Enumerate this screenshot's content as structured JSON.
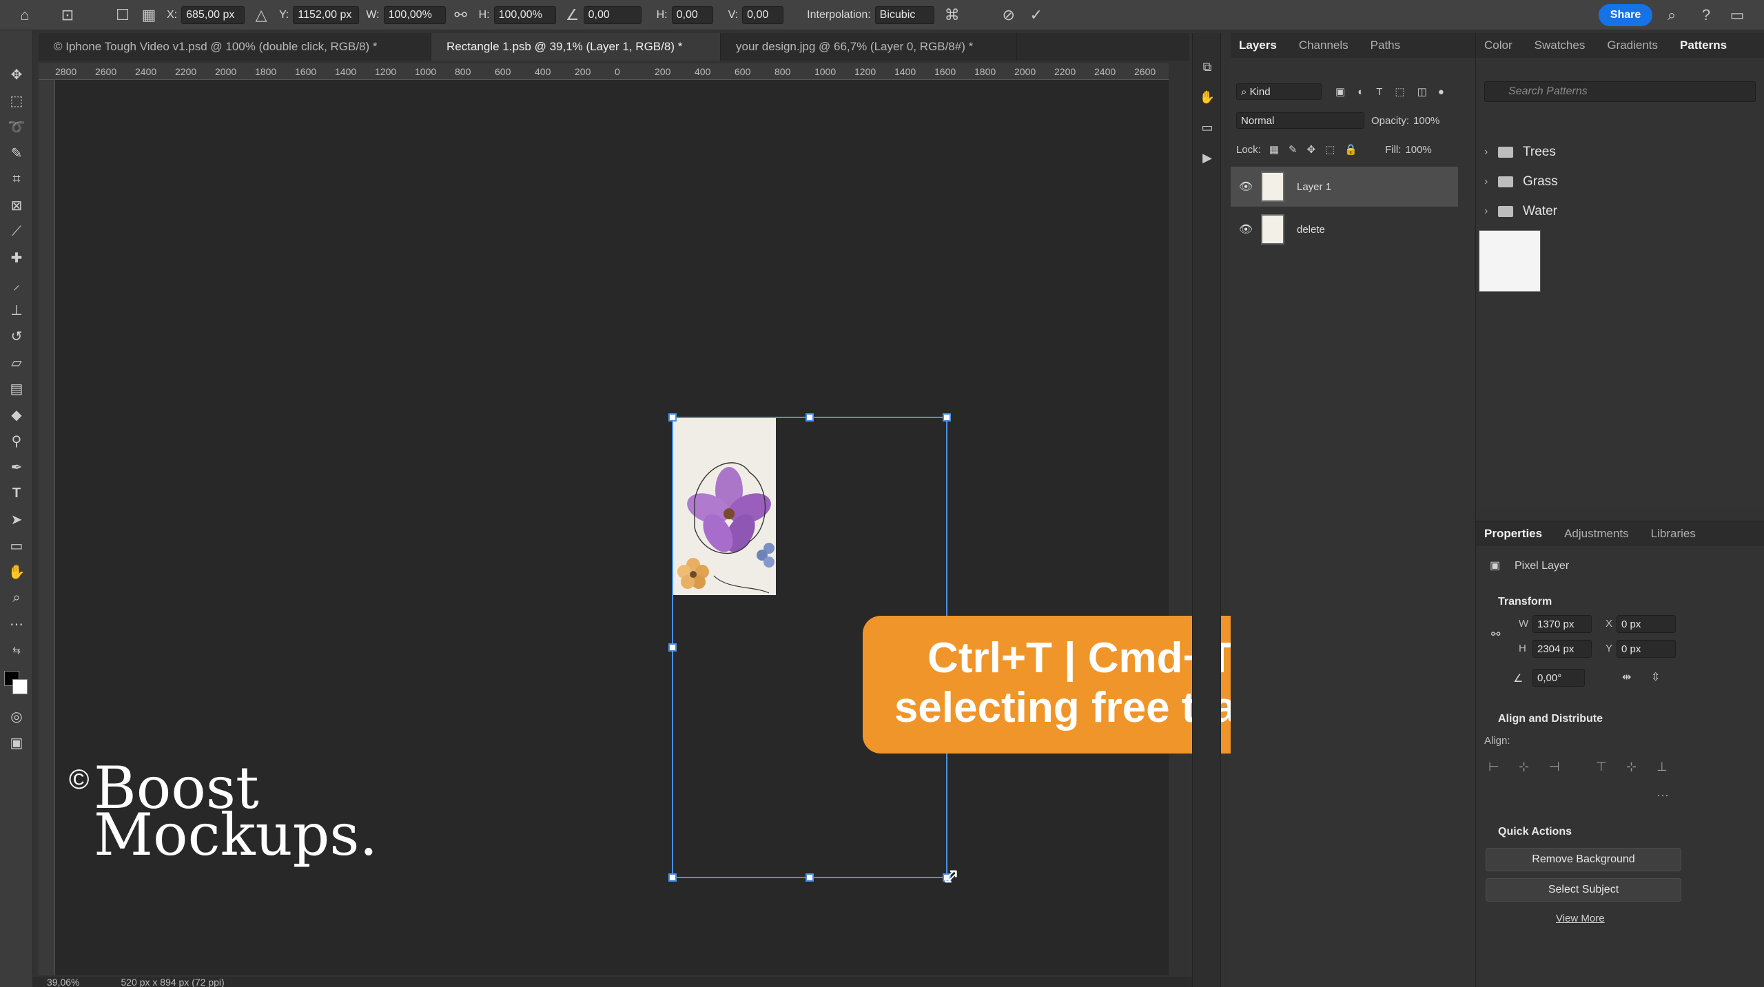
{
  "options_bar": {
    "x_label": "X:",
    "x_value": "685,00 px",
    "y_label": "Y:",
    "y_value": "1152,00 px",
    "w_label": "W:",
    "w_value": "100,00%",
    "h_label": "H:",
    "h_value": "100,00%",
    "angle_value": "0,00",
    "hskew_label": "H:",
    "hskew_value": "0,00",
    "vskew_label": "V:",
    "vskew_value": "0,00",
    "interp_label": "Interpolation:",
    "interp_value": "Bicubic",
    "share_label": "Share"
  },
  "tabs": [
    {
      "label": "© Iphone Tough Video v1.psd @ 100% (double click, RGB/8) *"
    },
    {
      "label": "Rectangle 1.psb @ 39,1% (Layer 1, RGB/8) *"
    },
    {
      "label": "your design.jpg @ 66,7% (Layer 0, RGB/8#) *"
    }
  ],
  "ruler_ticks": [
    "2800",
    "2600",
    "2400",
    "2200",
    "2000",
    "1800",
    "1600",
    "1400",
    "1200",
    "1000",
    "800",
    "600",
    "400",
    "200",
    "0",
    "200",
    "400",
    "600",
    "800",
    "1000",
    "1200",
    "1400",
    "1600",
    "1800",
    "2000",
    "2200",
    "2400",
    "2600"
  ],
  "callout": {
    "line1": "Ctrl+T | Cmd+T(mac)",
    "line2": "selecting free transform"
  },
  "watermark": {
    "symbol": "©",
    "line1": "Boost",
    "line2": "Mockups."
  },
  "layers_panel": {
    "tabs": [
      "Layers",
      "Channels",
      "Paths"
    ],
    "kind_label": "Kind",
    "blend_mode": "Normal",
    "opacity_label": "Opacity:",
    "opacity_value": "100%",
    "lock_label": "Lock:",
    "fill_label": "Fill:",
    "fill_value": "100%",
    "layers": [
      {
        "name": "Layer 1"
      },
      {
        "name": "delete"
      }
    ]
  },
  "patterns_panel": {
    "tabs": [
      "Color",
      "Swatches",
      "Gradients",
      "Patterns"
    ],
    "search_placeholder": "Search Patterns",
    "folders": [
      "Trees",
      "Grass",
      "Water"
    ]
  },
  "properties_panel": {
    "tabs": [
      "Properties",
      "Adjustments",
      "Libraries"
    ],
    "type_label": "Pixel Layer",
    "transform_title": "Transform",
    "w_label": "W",
    "w_value": "1370 px",
    "x_label": "X",
    "x_value": "0 px",
    "h_label": "H",
    "h_value": "2304 px",
    "y_label": "Y",
    "y_value": "0 px",
    "angle_value": "0,00°",
    "align_title": "Align and Distribute",
    "align_label": "Align:",
    "quick_title": "Quick Actions",
    "remove_bg": "Remove Background",
    "select_subject": "Select Subject",
    "view_more": "View More"
  },
  "status_bar": {
    "zoom": "39,06%",
    "doc_info": "520 px x 894 px (72 ppi)"
  }
}
